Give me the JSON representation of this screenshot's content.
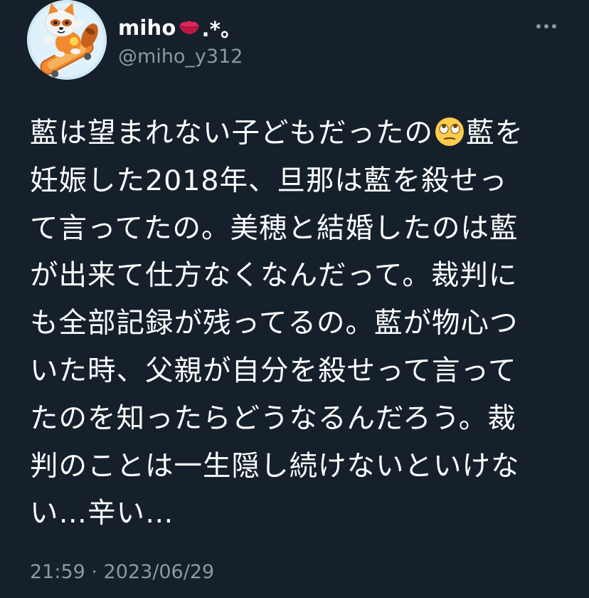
{
  "tweet": {
    "author": {
      "name": "miho",
      "name_emoji": "kiss-mark-icon",
      "name_suffix": " .*。",
      "handle": "@miho_y312",
      "avatar": "raccoon-skateboard-avatar"
    },
    "more_icon": "ellipsis-icon",
    "text_lines": {
      "l1a": "藍は望まれない子どもだったの",
      "l1_emoji": "face-with-rolling-eyes-icon",
      "l1b": "藍を",
      "l2": "妊娠した2018年、旦那は藍を殺せっ",
      "l3": "て言ってたの。美穂と結婚したのは藍",
      "l4": "が出来て仕方なくなんだって。裁判に",
      "l5": "も全部記録が残ってるの。藍が物心つ",
      "l6": "いた時、父親が自分を殺せって言って",
      "l7": "たのを知ったらどうなるんだろう。裁",
      "l8": "判のことは一生隠し続けないといけな",
      "l9": "い…辛い…"
    },
    "timestamp": "21:59 · 2023/06/29"
  },
  "colors": {
    "background": "#15202b",
    "text": "#ffffff",
    "secondary_text": "#8b98a5",
    "kiss_red": "#e0245e",
    "emoji_yellow": "#ffcc4d"
  }
}
